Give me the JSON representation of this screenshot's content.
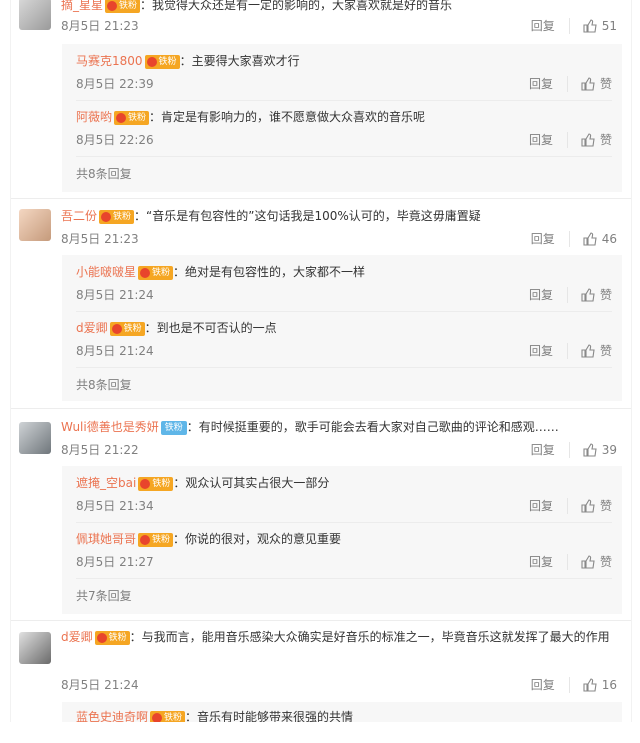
{
  "threads": [
    {
      "user": "摘_星星",
      "badge": "铁粉",
      "text": "：我觉得大众还是有一定的影响的，大家喜欢就是好的音乐",
      "time": "8月5日 21:23",
      "reply": "回复",
      "likes": "51",
      "subs": [
        {
          "user": "马赛克1800",
          "badge": "铁粉",
          "text": "：主要得大家喜欢才行",
          "time": "8月5日 22:39",
          "reply": "回复",
          "like": "赞"
        },
        {
          "user": "阿薇哟",
          "badge": "铁粉",
          "text": "：肯定是有影响力的，谁不愿意做大众喜欢的音乐呢",
          "time": "8月5日 22:26",
          "reply": "回复",
          "like": "赞"
        }
      ],
      "more": "共8条回复"
    },
    {
      "user": "吾二份",
      "badge": "铁粉",
      "text": "：“音乐是有包容性的”这句话我是100%认可的，毕竟这毋庸置疑",
      "time": "8月5日 21:23",
      "reply": "回复",
      "likes": "46",
      "subs": [
        {
          "user": "小能啵啵星",
          "badge": "铁粉",
          "text": "：绝对是有包容性的，大家都不一样",
          "time": "8月5日 21:24",
          "reply": "回复",
          "like": "赞"
        },
        {
          "user": "d爱卿",
          "badge": "铁粉",
          "text": "：到也是不可否认的一点",
          "time": "8月5日 21:24",
          "reply": "回复",
          "like": "赞"
        }
      ],
      "more": "共8条回复"
    },
    {
      "user": "Wuli德善也是秀妍",
      "badge": "铁粉",
      "text": "：有时候挺重要的，歌手可能会去看大家对自己歌曲的评论和感观……",
      "time": "8月5日 21:22",
      "reply": "回复",
      "likes": "39",
      "subs": [
        {
          "user": "遮掩_空bai",
          "badge": "铁粉",
          "text": "：观众认可其实占很大一部分",
          "time": "8月5日 21:34",
          "reply": "回复",
          "like": "赞"
        },
        {
          "user": "佩琪她哥哥",
          "badge": "铁粉",
          "text": "：你说的很对，观众的意见重要",
          "time": "8月5日 21:27",
          "reply": "回复",
          "like": "赞"
        }
      ],
      "more": "共7条回复"
    },
    {
      "user": "d爱卿",
      "badge": "铁粉",
      "text": "：与我而言，能用音乐感染大众确实是好音乐的标准之一，毕竟音乐这就发挥了最大的作用",
      "time": "8月5日 21:24",
      "reply": "回复",
      "likes": "16",
      "subs": [
        {
          "user": "蓝色史迪奇啊",
          "badge": "铁粉",
          "text": "：音乐有时能够带来很强的共情"
        }
      ]
    }
  ]
}
